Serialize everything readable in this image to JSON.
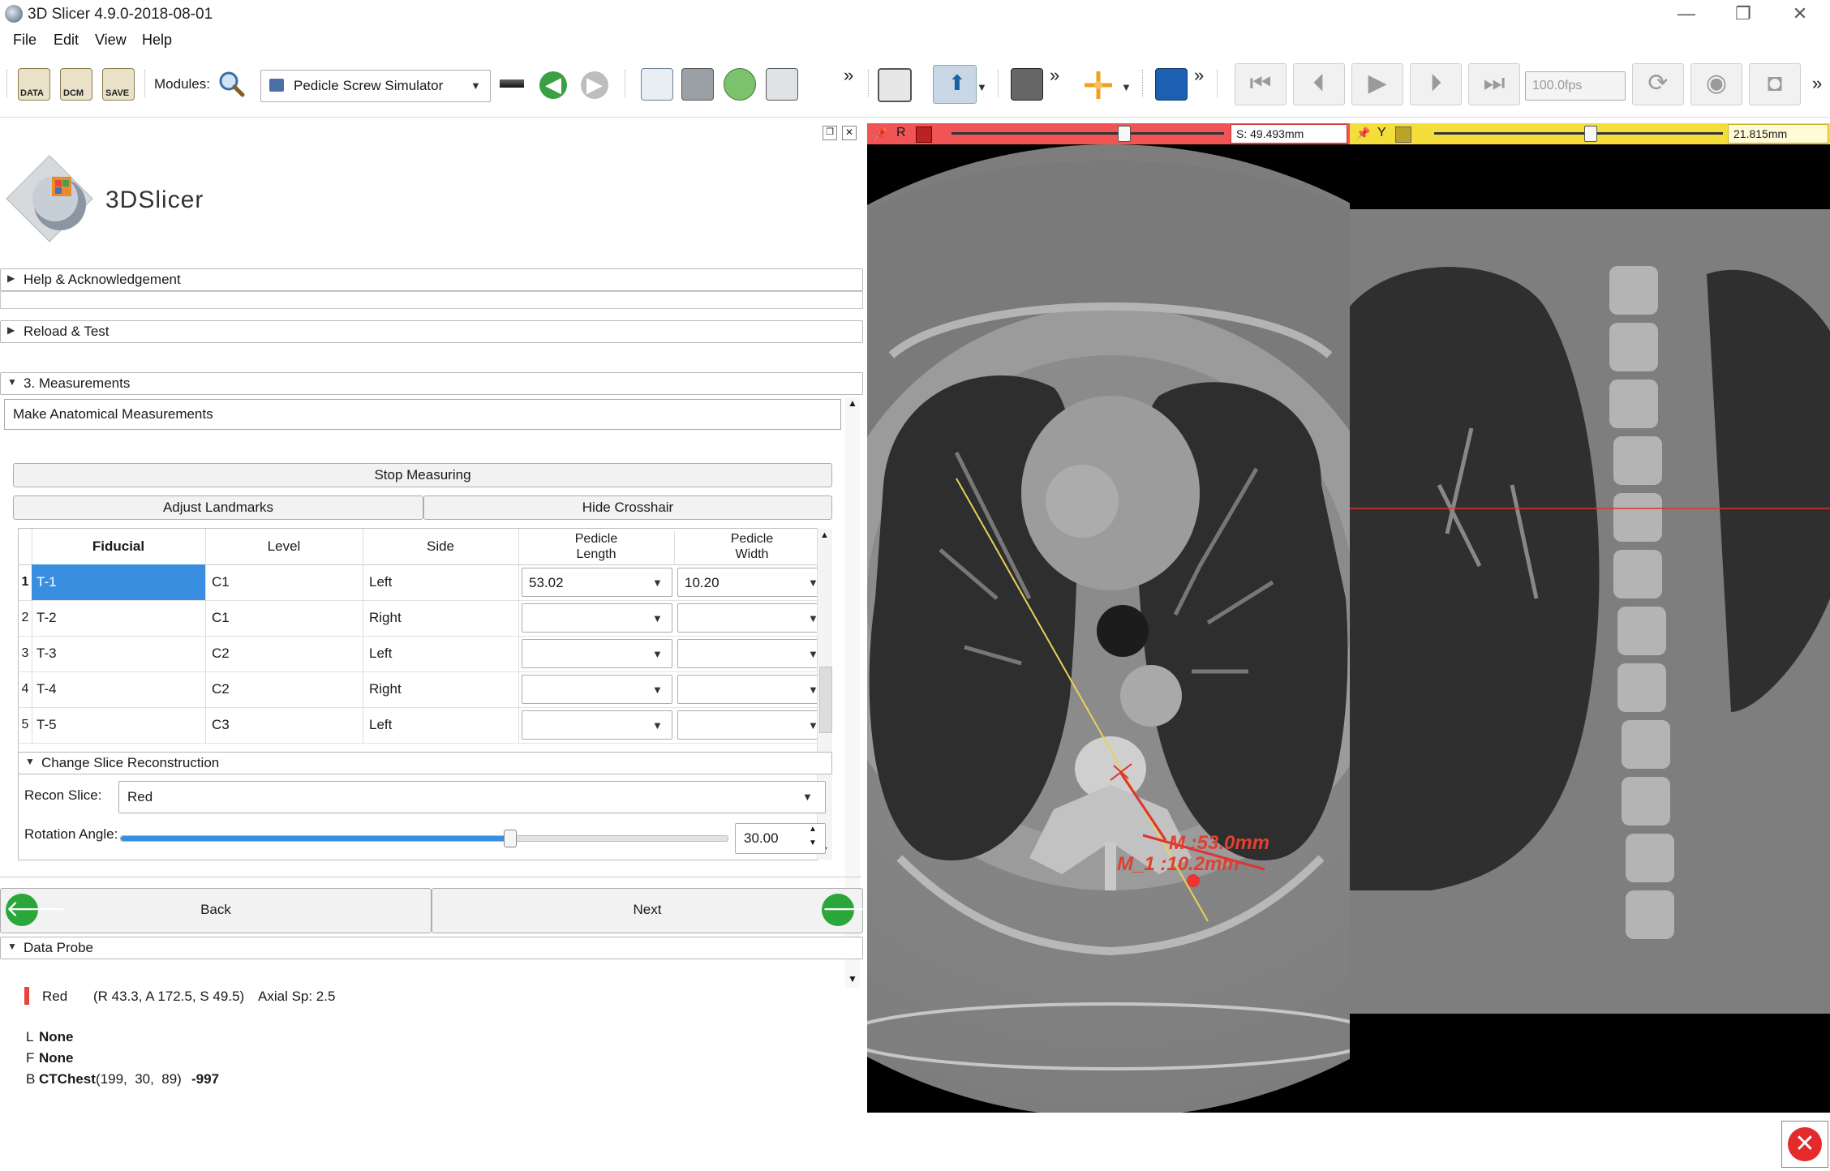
{
  "window": {
    "title": "3D Slicer 4.9.0-2018-08-01",
    "controls": [
      "—",
      "❐",
      "✕"
    ]
  },
  "menu": [
    "File",
    "Edit",
    "View",
    "Help"
  ],
  "toolbar": {
    "data_label": "DATA",
    "dcm_label": "DCM",
    "save_label": "SAVE",
    "modules_label": "Modules:",
    "module_selected": "Pedicle Screw Simulator",
    "more_glyph": "»",
    "fps_value": "100.0fps"
  },
  "logo": {
    "text": "3DSlicer"
  },
  "sections": {
    "help": "Help & Acknowledgement",
    "reload": "Reload & Test",
    "measurements": "3. Measurements",
    "instruction": "Make Anatomical Measurements",
    "data_probe": "Data Probe"
  },
  "buttons": {
    "stop_measuring": "Stop Measuring",
    "adjust_landmarks": "Adjust Landmarks",
    "hide_crosshair": "Hide Crosshair",
    "back": "Back",
    "next": "Next"
  },
  "table": {
    "headers": [
      "Fiducial",
      "Level",
      "Side",
      "Pedicle\nLength",
      "Pedicle\nWidth"
    ],
    "rows": [
      {
        "num": "1",
        "fiducial": "T-1",
        "level": "C1",
        "side": "Left",
        "length": "53.02",
        "width": "10.20"
      },
      {
        "num": "2",
        "fiducial": "T-2",
        "level": "C1",
        "side": "Right",
        "length": "",
        "width": ""
      },
      {
        "num": "3",
        "fiducial": "T-3",
        "level": "C2",
        "side": "Left",
        "length": "",
        "width": ""
      },
      {
        "num": "4",
        "fiducial": "T-4",
        "level": "C2",
        "side": "Right",
        "length": "",
        "width": ""
      },
      {
        "num": "5",
        "fiducial": "T-5",
        "level": "C3",
        "side": "Left",
        "length": "",
        "width": ""
      }
    ]
  },
  "recon": {
    "section": "Change Slice Reconstruction",
    "slice_label": "Recon Slice:",
    "slice_value": "Red",
    "angle_label": "Rotation Angle:",
    "angle_value": "30.00",
    "angle_fraction": 0.64
  },
  "probe": {
    "view": "Red",
    "coords": "(R 43.3, A 172.5, S 49.5)",
    "spacing": "Axial Sp: 2.5",
    "l_key": "L",
    "l_val": "None",
    "f_key": "F",
    "f_val": "None",
    "b_key": "B",
    "b_name": "CTChest",
    "b_ijk": "(199,  30,  89)",
    "b_value": "-997"
  },
  "views": {
    "red": {
      "letter": "R",
      "offset": "S: 49.493mm",
      "slider_fraction": 0.63,
      "color": "#f05454"
    },
    "yellow": {
      "letter": "Y",
      "offset": "21.815mm",
      "slider_fraction": 0.54,
      "color": "#f5de3c"
    },
    "measure_length": "M :53.0mm",
    "measure_width": "M_1 :10.2mm"
  },
  "colors": {
    "selection": "#3a8ee0",
    "red_indicator": "#e8443a",
    "arrow_green": "#2aa63b"
  }
}
